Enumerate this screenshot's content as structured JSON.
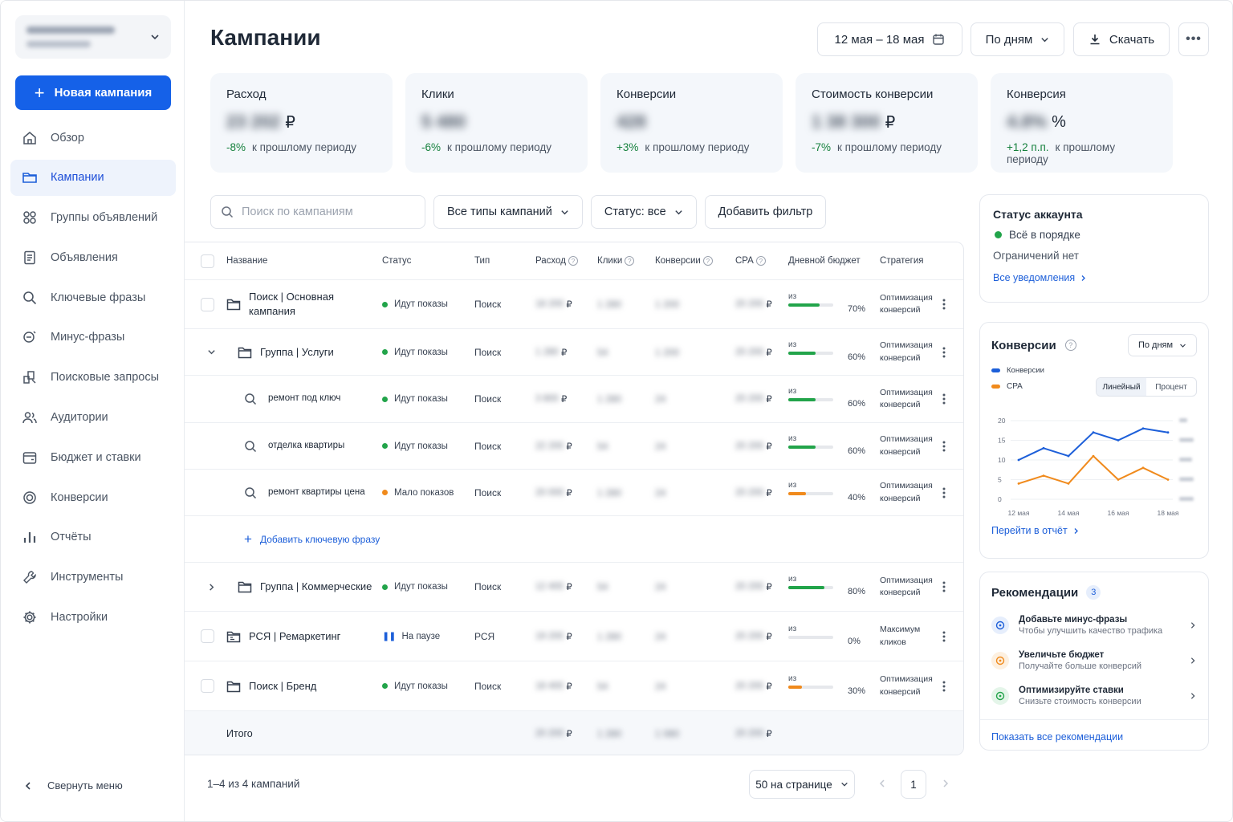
{
  "sidebar": {
    "new_campaign": "Новая кампания",
    "collapse": "Свернуть меню",
    "items": [
      {
        "label": "Обзор",
        "icon": "home-icon"
      },
      {
        "label": "Кампании",
        "icon": "folder-icon"
      },
      {
        "label": "Группы объявлений",
        "icon": "grid-icon"
      },
      {
        "label": "Объявления",
        "icon": "document-icon"
      },
      {
        "label": "Ключевые фразы",
        "icon": "search-icon"
      },
      {
        "label": "Минус-фразы",
        "icon": "minus-search-icon"
      },
      {
        "label": "Поисковые запросы",
        "icon": "query-icon"
      },
      {
        "label": "Аудитории",
        "icon": "users-icon"
      },
      {
        "label": "Бюджет и ставки",
        "icon": "wallet-icon"
      },
      {
        "label": "Конверсии",
        "icon": "target-icon"
      },
      {
        "label": "Отчёты",
        "icon": "bar-chart-icon"
      },
      {
        "label": "Инструменты",
        "icon": "wrench-icon"
      },
      {
        "label": "Настройки",
        "icon": "gear-icon"
      }
    ]
  },
  "header": {
    "title": "Кампании",
    "date_range": "12 мая – 18 мая",
    "period": "По дням",
    "download": "Скачать"
  },
  "kpis": [
    {
      "title": "Расход",
      "unit": "₽",
      "delta": "-8%",
      "delta_text": "к прошлому периоду"
    },
    {
      "title": "Клики",
      "unit": "",
      "delta": "-6%",
      "delta_text": "к прошлому периоду"
    },
    {
      "title": "Конверсии",
      "unit": "",
      "delta": "+3%",
      "delta_text": "к прошлому периоду"
    },
    {
      "title": "Стоимость конверсии",
      "unit": "₽",
      "delta": "-7%",
      "delta_text": "к прошлому периоду"
    },
    {
      "title": "Конверсия",
      "unit": "%",
      "delta": "+1,2 п.п.",
      "delta_text": "к прошлому периоду"
    }
  ],
  "filters": {
    "search_placeholder": "Поиск по кампаниям",
    "types": "Все типы кампаний",
    "status": "Статус: все",
    "add_filter": "Добавить фильтр"
  },
  "table": {
    "columns": [
      "Название",
      "Статус",
      "Тип",
      "Расход",
      "Клики",
      "Конверсии",
      "CPA",
      "Дневной бюджет",
      "Стратегия"
    ],
    "budget_prefix": "из",
    "add_keyword": "Добавить ключевую фразу",
    "total": "Итого",
    "rows": [
      {
        "name": "Поиск | Основная кампания",
        "status": "Идут показы",
        "status_color": "#22a44a",
        "type": "Поиск",
        "budget": 70,
        "budget_label": "70%",
        "bar_color": "#22a44a",
        "strategy": "Оптимизация конверсий",
        "kind": "campaign"
      },
      {
        "name": "Группа | Услуги",
        "status": "Идут показы",
        "status_color": "#22a44a",
        "type": "Поиск",
        "budget": 60,
        "budget_label": "60%",
        "bar_color": "#22a44a",
        "strategy": "Оптимизация конверсий",
        "kind": "group-open"
      },
      {
        "name": "ремонт под ключ",
        "status": "Идут показы",
        "status_color": "#22a44a",
        "type": "Поиск",
        "budget": 60,
        "budget_label": "60%",
        "bar_color": "#22a44a",
        "strategy": "Оптимизация конверсий",
        "kind": "keyword"
      },
      {
        "name": "отделка квартиры",
        "status": "Идут показы",
        "status_color": "#22a44a",
        "type": "Поиск",
        "budget": 60,
        "budget_label": "60%",
        "bar_color": "#22a44a",
        "strategy": "Оптимизация конверсий",
        "kind": "keyword"
      },
      {
        "name": "ремонт квартиры цена",
        "status": "Мало показов",
        "status_color": "#f08a1c",
        "type": "Поиск",
        "budget": 40,
        "budget_label": "40%",
        "bar_color": "#f08a1c",
        "strategy": "Оптимизация конверсий",
        "kind": "keyword"
      },
      {
        "name": "Группа | Коммерческие",
        "status": "Идут показы",
        "status_color": "#22a44a",
        "type": "Поиск",
        "budget": 80,
        "budget_label": "80%",
        "bar_color": "#22a44a",
        "strategy": "Оптимизация конверсий",
        "kind": "group-closed"
      },
      {
        "name": "РСЯ | Ремаркетинг",
        "status": "На паузе",
        "status_color": "#1d5fd9",
        "type": "РСЯ",
        "budget": 0,
        "budget_label": "0%",
        "bar_color": "#22a44a",
        "strategy": "Максимум кликов",
        "kind": "campaign-rsya"
      },
      {
        "name": "Поиск | Бренд",
        "status": "Идут показы",
        "status_color": "#22a44a",
        "type": "Поиск",
        "budget": 30,
        "budget_label": "30%",
        "bar_color": "#f08a1c",
        "strategy": "Оптимизация конверсий",
        "kind": "campaign"
      }
    ]
  },
  "pagination": {
    "summary": "1–4 из 4 кампаний",
    "per_page": "50 на странице",
    "page": "1"
  },
  "account_status": {
    "title": "Статус аккаунта",
    "status": "Всё в порядке",
    "limits": "Ограничений нет",
    "link": "Все уведомления"
  },
  "conversions_card": {
    "title": "Конверсии",
    "period": "По дням",
    "legend": [
      "Конверсии",
      "CPA"
    ],
    "toggle": [
      "Линейный",
      "Процент"
    ],
    "link": "Перейти в отчёт",
    "colors": {
      "conversions": "#1d5fd9",
      "cpa": "#f08a1c"
    }
  },
  "chart_data": {
    "type": "line",
    "x": [
      "12 мая",
      "13 мая",
      "14 мая",
      "15 мая",
      "16 мая",
      "17 мая",
      "18 мая"
    ],
    "x_tick_labels": [
      "12 мая",
      "14 мая",
      "16 мая",
      "18 мая"
    ],
    "y_ticks": [
      "0",
      "5",
      "10",
      "15",
      "20"
    ],
    "ylim": [
      0,
      20
    ],
    "series": [
      {
        "name": "Конверсии",
        "values": [
          10,
          13,
          11,
          17,
          15,
          18,
          17
        ]
      },
      {
        "name": "CPA",
        "values": [
          4,
          6,
          4,
          11,
          5,
          8,
          5
        ]
      }
    ],
    "legend_position": "top-left"
  },
  "recommendations": {
    "title": "Рекомендации",
    "count": "3",
    "link": "Показать все рекомендации",
    "items": [
      {
        "title": "Добавьте минус-фразы",
        "subtitle": "Чтобы улучшить качество трафика",
        "color": "#1d5fd9",
        "bg": "#e6eefc"
      },
      {
        "title": "Увеличьте бюджет",
        "subtitle": "Получайте больше конверсий",
        "color": "#f08a1c",
        "bg": "#fdf0e0"
      },
      {
        "title": "Оптимизируйте ставки",
        "subtitle": "Снизьте стоимость конверсии",
        "color": "#22a44a",
        "bg": "#e4f5e9"
      }
    ]
  }
}
